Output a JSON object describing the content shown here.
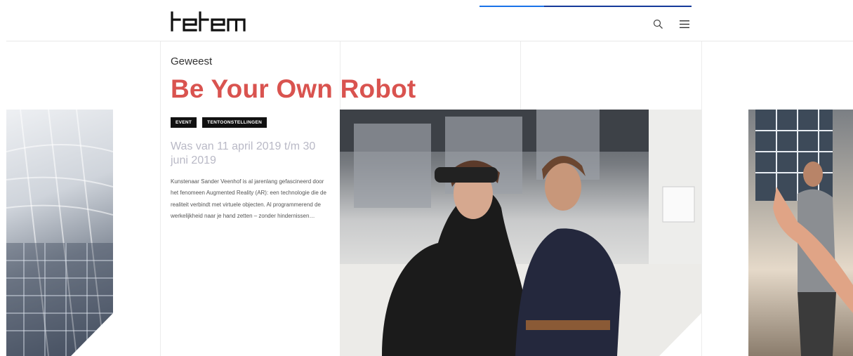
{
  "header": {
    "logo_text": "tetem",
    "search_icon": "search-icon",
    "menu_icon": "menu-icon"
  },
  "article": {
    "category": "Geweest",
    "title": "Be Your Own Robot",
    "tags": [
      "EVENT",
      "TENTOONSTELLINGEN"
    ],
    "dates": "Was van 11 april 2019 t/m 30 juni 2019",
    "description": "Kunstenaar Sander Veenhof is al jarenlang gefascineerd door het fenomeen Augmented Reality (AR): een technologie die de realiteit verbindt met virtuele objecten. Al programmerend de werkelijkheid naar je hand zetten – zonder hindernissen…"
  },
  "colors": {
    "title": "#d9534f",
    "tag_bg": "#111111",
    "dates": "#b9b9c6"
  }
}
